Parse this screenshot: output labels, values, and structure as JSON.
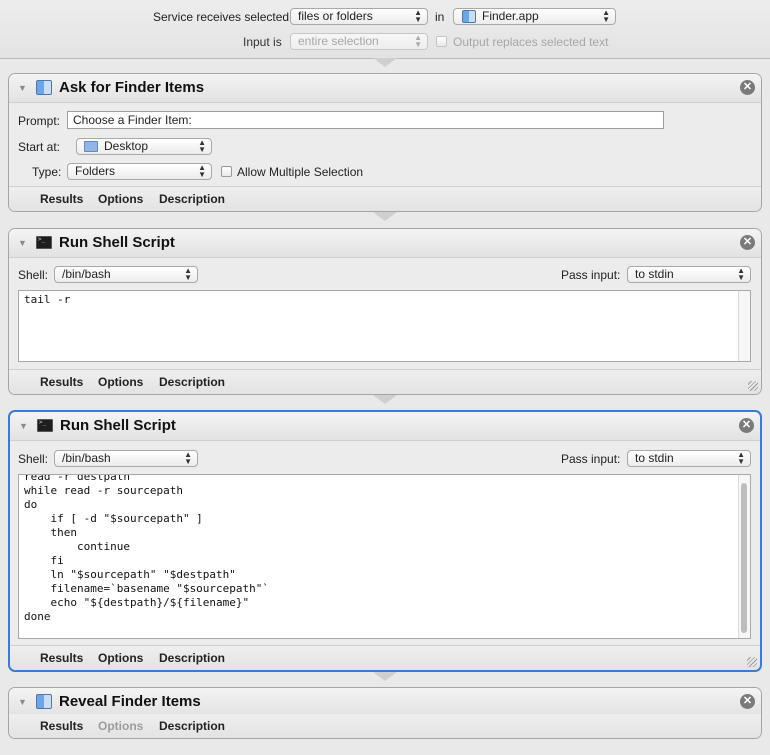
{
  "top": {
    "service_label": "Service receives selected",
    "service_value": "files or folders",
    "in_label": "in",
    "app_value": "Finder.app",
    "input_label": "Input is",
    "input_value": "entire selection",
    "output_replaces_label": "Output replaces selected text"
  },
  "footer_tabs": {
    "results": "Results",
    "options": "Options",
    "description": "Description"
  },
  "action1": {
    "title": "Ask for Finder Items",
    "prompt_label": "Prompt:",
    "prompt_value": "Choose a Finder Item:",
    "start_label": "Start at:",
    "start_value": "Desktop",
    "type_label": "Type:",
    "type_value": "Folders",
    "allow_multiple_label": "Allow Multiple Selection"
  },
  "action2": {
    "title": "Run Shell Script",
    "shell_label": "Shell:",
    "shell_value": "/bin/bash",
    "pass_label": "Pass input:",
    "pass_value": "to stdin",
    "script": "tail -r"
  },
  "action3": {
    "title": "Run Shell Script",
    "shell_label": "Shell:",
    "shell_value": "/bin/bash",
    "pass_label": "Pass input:",
    "pass_value": "to stdin",
    "script": "read -r destpath\nwhile read -r sourcepath\ndo\n    if [ -d \"$sourcepath\" ]\n    then\n        continue\n    fi\n    ln \"$sourcepath\" \"$destpath\"\n    filename=`basename \"$sourcepath\"`\n    echo \"${destpath}/${filename}\"\ndone"
  },
  "action4": {
    "title": "Reveal Finder Items"
  }
}
